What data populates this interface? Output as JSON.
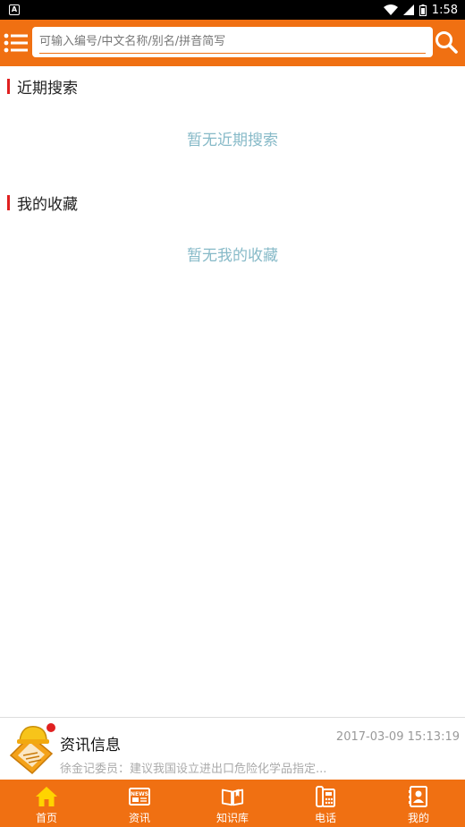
{
  "statusbar": {
    "notification_label": "A",
    "time": "1:58"
  },
  "search": {
    "placeholder": "可输入编号/中文名称/别名/拼音简写",
    "value": ""
  },
  "recent": {
    "title": "近期搜索",
    "empty": "暂无近期搜索"
  },
  "favorites": {
    "title": "我的收藏",
    "empty": "暂无我的收藏"
  },
  "news": {
    "title": "资讯信息",
    "time": "2017-03-09 15:13:19",
    "summary": "徐金记委员：建议我国设立进出口危险化学品指定..."
  },
  "tabs": [
    {
      "label": "首页",
      "icon": "home-icon",
      "active": true
    },
    {
      "label": "资讯",
      "icon": "news-icon",
      "active": false
    },
    {
      "label": "知识库",
      "icon": "book-icon",
      "active": false
    },
    {
      "label": "电话",
      "icon": "phone-icon",
      "active": false
    },
    {
      "label": "我的",
      "icon": "contact-book-icon",
      "active": false
    }
  ],
  "colors": {
    "brand": "#f07012",
    "accent_red": "#e02020",
    "hint": "#87bac8",
    "active_tab_icon": "#ffd400"
  }
}
